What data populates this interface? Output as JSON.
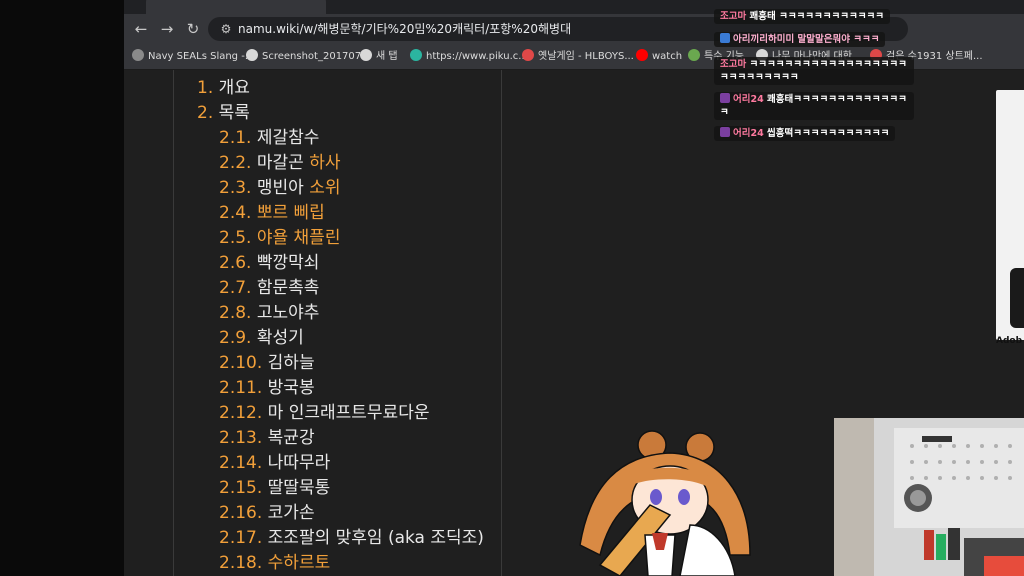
{
  "browser": {
    "url": "namu.wiki/w/해병문학/기타%20밈%20캐릭터/포항%20해병대",
    "nav": {
      "back_icon": "←",
      "forward_icon": "→",
      "reload_icon": "↻",
      "site_info_icon": "⚙"
    },
    "bookmarks": [
      {
        "label": "Navy SEALs Slang -...",
        "color": "#8a8a8a"
      },
      {
        "label": "Screenshot_201707...",
        "color": "#d8d8d8"
      },
      {
        "label": "새 탭",
        "color": "#d8d8d8"
      },
      {
        "label": "https://www.piku.c...",
        "color": "#2bb5a0"
      },
      {
        "label": "옛날게임 - HLBOYS...",
        "color": "#e04848"
      },
      {
        "label": "watch",
        "color": "#ff0000"
      },
      {
        "label": "특수 기능",
        "color": "#6aa84f"
      },
      {
        "label": "나무 마나만에 대한",
        "color": "#d8d8d8"
      },
      {
        "label": "검은 수1931 상트페...",
        "color": "#e04848"
      }
    ]
  },
  "toc": {
    "items": [
      {
        "num": "1.",
        "text": "개요",
        "link": false,
        "level": 1
      },
      {
        "num": "2.",
        "text": "목록",
        "link": false,
        "level": 1
      },
      {
        "num": "2.1.",
        "text": "제갈참수",
        "link": false,
        "level": 2
      },
      {
        "num": "2.2.",
        "text": "마갈곤 ",
        "link_text": "하사",
        "link": false,
        "level": 2
      },
      {
        "num": "2.3.",
        "text": "맹빈아 ",
        "link_text": "소위",
        "link": false,
        "level": 2
      },
      {
        "num": "2.4.",
        "text": "뽀르 삐립",
        "link": true,
        "level": 2
      },
      {
        "num": "2.5.",
        "text": "야욜 채플린",
        "link": true,
        "level": 2
      },
      {
        "num": "2.6.",
        "text": "빡깡막쇠",
        "link": false,
        "level": 2
      },
      {
        "num": "2.7.",
        "text": "함문촉촉",
        "link": false,
        "level": 2
      },
      {
        "num": "2.8.",
        "text": "고노야추",
        "link": false,
        "level": 2
      },
      {
        "num": "2.9.",
        "text": "확성기",
        "link": false,
        "level": 2
      },
      {
        "num": "2.10.",
        "text": "김하늘",
        "link": false,
        "level": 2
      },
      {
        "num": "2.11.",
        "text": "방국봉",
        "link": false,
        "level": 2
      },
      {
        "num": "2.12.",
        "text": "마 인크래프트무료다운",
        "link": false,
        "level": 2
      },
      {
        "num": "2.13.",
        "text": "복균강",
        "link": false,
        "level": 2
      },
      {
        "num": "2.14.",
        "text": "나따무라",
        "link": false,
        "level": 2
      },
      {
        "num": "2.15.",
        "text": "딸딸묵통",
        "link": false,
        "level": 2
      },
      {
        "num": "2.16.",
        "text": "코가손",
        "link": false,
        "level": 2
      },
      {
        "num": "2.17.",
        "text": "조조팔의 맞후임 (aka 조딕조)",
        "link": false,
        "level": 2
      },
      {
        "num": "2.18.",
        "text": "수하르토",
        "link": true,
        "level": 2
      }
    ]
  },
  "chat": {
    "messages": [
      {
        "nick": "조고마",
        "text": "쾌흥태 ㅋㅋㅋㅋㅋㅋㅋㅋㅋㅋㅋㅋ",
        "badge_color": ""
      },
      {
        "nick": "",
        "text": "아리끼리하미미 말말말은뭐야 ㅋㅋㅋ",
        "badge_color": "#3a7bd5"
      },
      {
        "nick": "조고마",
        "text": "ㅋㅋㅋㅋㅋㅋㅋㅋㅋㅋㅋㅋㅋㅋㅋㅋㅋㅋㅋㅋㅋㅋㅋㅋㅋㅋㅋ",
        "badge_color": ""
      },
      {
        "nick": "어리24",
        "text": "쾌흥태ㅋㅋㅋㅋㅋㅋㅋㅋㅋㅋㅋㅋㅋㅋ",
        "badge_color": "#7b3fa0"
      },
      {
        "nick": "어리24",
        "text": "씹흥떡ㅋㅋㅋㅋㅋㅋㅋㅋㅋㅋㅋ",
        "badge_color": "#7b3fa0"
      }
    ]
  },
  "right_panel": {
    "label": "Adob"
  }
}
